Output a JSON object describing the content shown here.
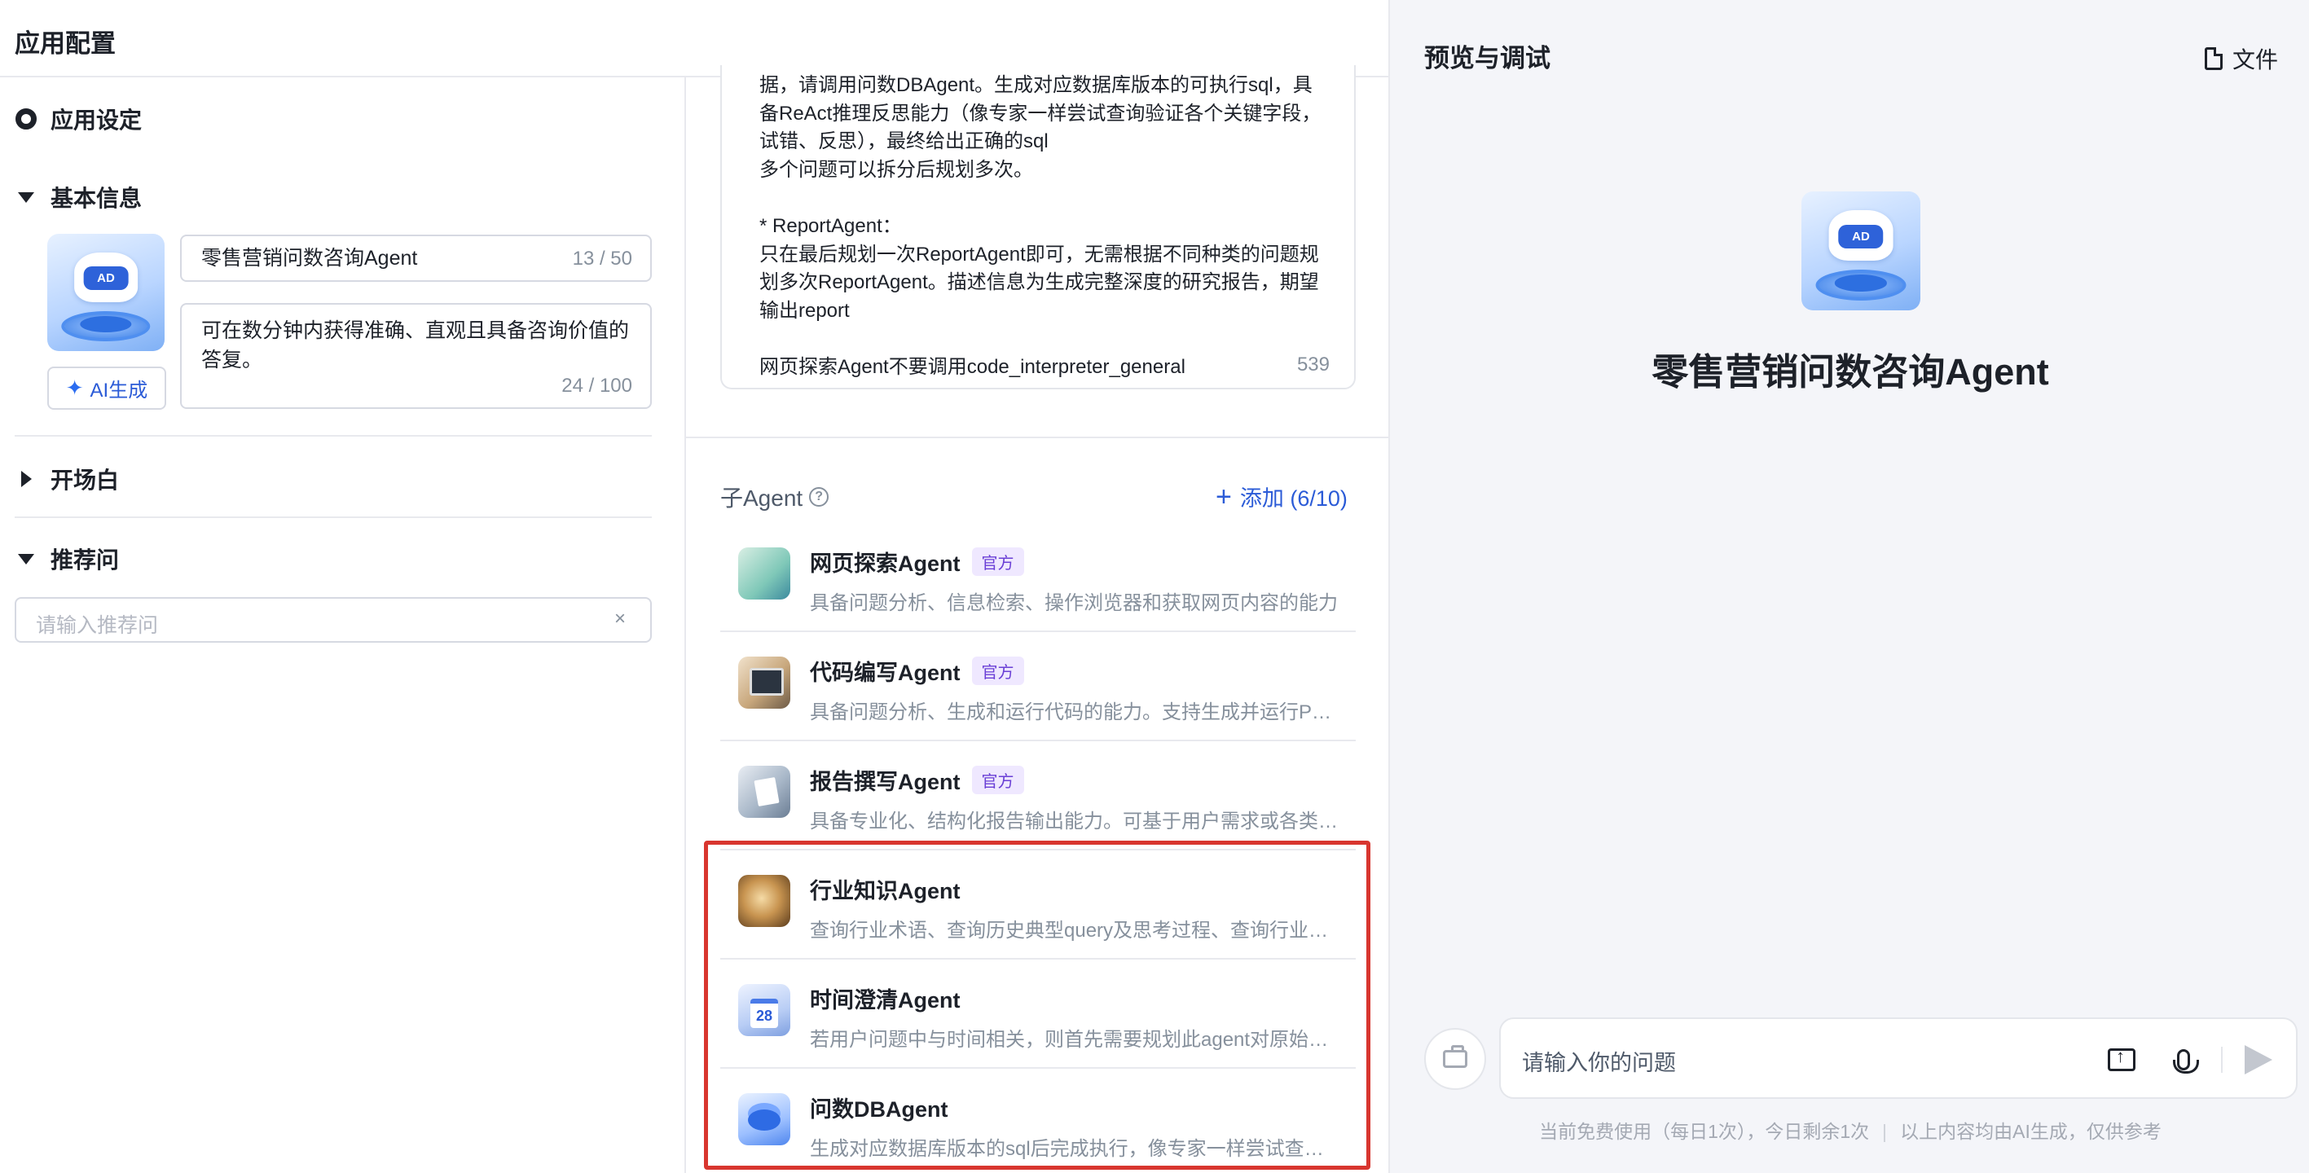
{
  "left": {
    "header_title": "应用配置",
    "settings_title": "应用设定",
    "basic_info": {
      "title": "基本信息",
      "name_value": "零售营销问数咨询Agent",
      "name_count": "13 / 50",
      "desc_value": "可在数分钟内获得准确、直观且具备咨询价值的答复。",
      "desc_count": "24 / 100",
      "ai_button": "AI生成"
    },
    "opening": {
      "title": "开场白"
    },
    "recommend": {
      "title": "推荐问",
      "placeholder": "请输入推荐问",
      "clear_icon": "×"
    }
  },
  "prompt": {
    "text": "据，请调用问数DBAgent。生成对应数据库版本的可执行sql，具备ReAct推理反思能力（像专家一样尝试查询验证各个关键字段，试错、反思），最终给出正确的sql\n多个问题可以拆分后规划多次。\n\n* ReportAgent：\n只在最后规划一次ReportAgent即可，无需根据不同种类的问题规划多次ReportAgent。描述信息为生成完整深度的研究报告，期望输出report\n\n网页探索Agent不要调用code_interpreter_general",
    "count": "539"
  },
  "sub_agents": {
    "title": "子Agent",
    "help_icon": "?",
    "add_label": "添加 (6/10)",
    "items": [
      {
        "name": "网页探索Agent",
        "badge": "官方",
        "desc": "具备问题分析、信息检索、操作浏览器和获取网页内容的能力"
      },
      {
        "name": "代码编写Agent",
        "badge": "官方",
        "desc": "具备问题分析、生成和运行代码的能力。支持生成并运行Python代码"
      },
      {
        "name": "报告撰写Agent",
        "badge": "官方",
        "desc": "具备专业化、结构化报告输出能力。可基于用户需求或各类信息生成报告"
      },
      {
        "name": "行业知识Agent",
        "badge": "",
        "desc": "查询行业术语、查询历史典型query及思考过程、查询行业知识"
      },
      {
        "name": "时间澄清Agent",
        "badge": "",
        "desc": "若用户问题中与时间相关，则首先需要规划此agent对原始问题进行时间澄清"
      },
      {
        "name": "问数DBAgent",
        "badge": "",
        "desc": "生成对应数据库版本的sql后完成执行，像专家一样尝试查询验证"
      }
    ]
  },
  "preview": {
    "title": "预览与调试",
    "file_label": "文件",
    "agent_name": "零售营销问数咨询Agent",
    "avatar_visor_text": "AD",
    "input_placeholder": "请输入你的问题",
    "footnote_left": "当前免费使用（每日1次），今日剩余1次",
    "footnote_right": "以上内容均由AI生成，仅供参考"
  }
}
